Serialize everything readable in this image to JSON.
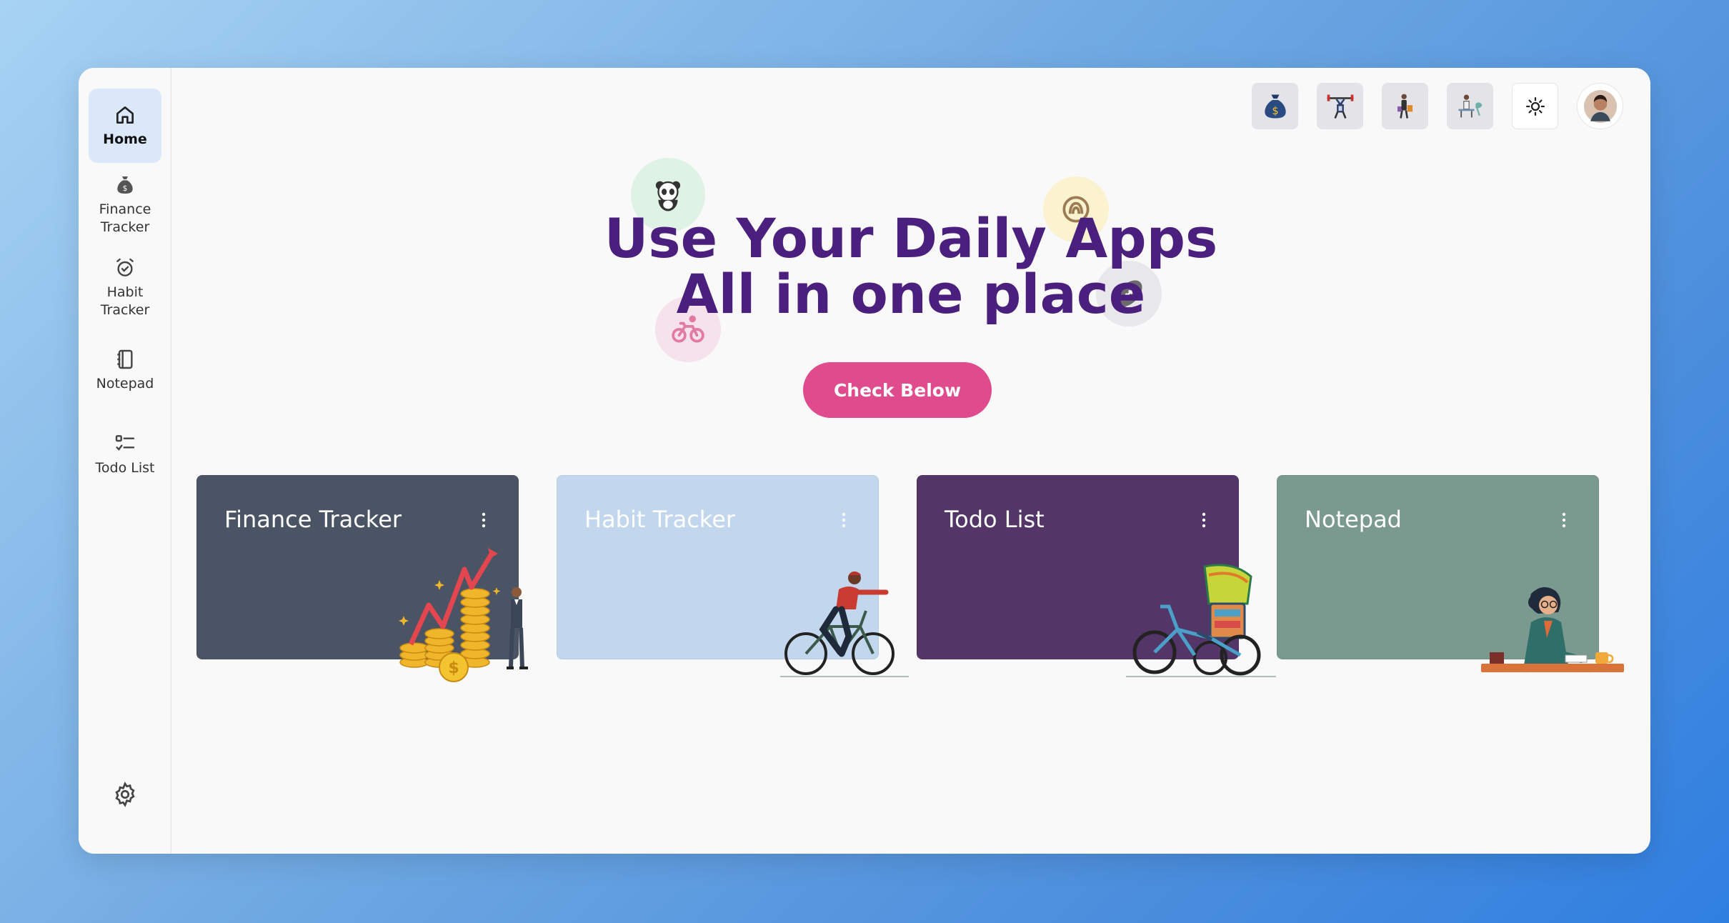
{
  "sidebar": {
    "items": [
      {
        "label": "Home",
        "icon": "home-icon"
      },
      {
        "label": "Finance\nTracker",
        "icon": "money-bag-icon"
      },
      {
        "label": "Habit\nTracker",
        "icon": "alarm-clock-icon"
      },
      {
        "label": "Notepad",
        "icon": "notebook-icon"
      },
      {
        "label": "Todo List",
        "icon": "checklist-icon"
      }
    ],
    "settings_icon": "gear-icon"
  },
  "topbar": {
    "buttons": [
      "money-bag-icon",
      "weightlifter-icon",
      "shopper-icon",
      "person-at-desk-icon"
    ],
    "theme_icon": "sun-icon",
    "avatar": "user-avatar"
  },
  "hero": {
    "title_line1": "Use Your Daily Apps",
    "title_line2": "All in one place",
    "button_label": "Check Below",
    "title_color": "#4b1f7d",
    "button_color": "#df4b8c"
  },
  "cards": [
    {
      "title": "Finance Tracker",
      "color": "#4a5464",
      "illustration": "coins-growth-illustration"
    },
    {
      "title": "Habit Tracker",
      "color": "#c2d7ee",
      "illustration": "cyclist-illustration"
    },
    {
      "title": "Todo List",
      "color": "#533567",
      "illustration": "rickshaw-illustration"
    },
    {
      "title": "Notepad",
      "color": "#7a998f",
      "illustration": "woman-writing-illustration"
    }
  ]
}
